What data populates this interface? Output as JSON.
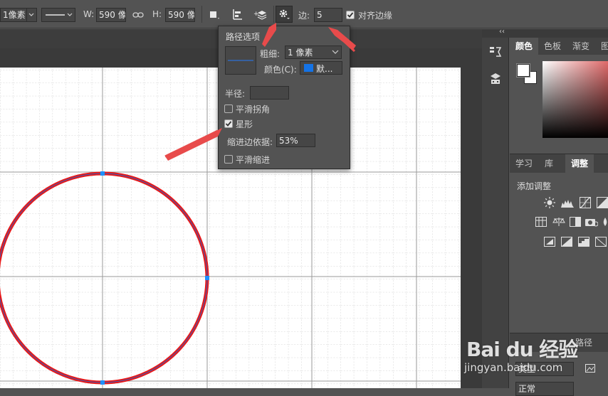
{
  "options_bar": {
    "stroke_width_value": "1像素",
    "w_label": "W:",
    "w_value": "590 像",
    "h_label": "H:",
    "h_value": "590 像",
    "sides_label": "边:",
    "sides_value": "5",
    "align_edges_label": "对齐边缘",
    "align_edges_checked": true
  },
  "path_options": {
    "title": "路径选项",
    "weight_label": "粗细:",
    "weight_value": "1 像素",
    "color_label": "颜色(C):",
    "color_value": "默...",
    "color_swatch": "#1473e6",
    "radius_label": "半径:",
    "radius_value": "",
    "smooth_corners_label": "平滑拐角",
    "smooth_corners_checked": false,
    "star_label": "星形",
    "star_checked": true,
    "indent_label": "缩进边依据:",
    "indent_value": "53%",
    "smooth_indents_label": "平滑缩进",
    "smooth_indents_checked": false
  },
  "right_panel": {
    "collapse_glyph": "‹‹",
    "color_tabs": [
      "颜色",
      "色板",
      "渐变",
      "图案"
    ],
    "adjust_tabs": [
      "学习",
      "库",
      "调整"
    ],
    "add_adjustment_label": "添加调整",
    "layers_tab_label": "路径",
    "kind_label": "类型",
    "normal_label": "正常"
  },
  "watermark": {
    "logo_text": "Bai du 经验",
    "url_text": "jingyan.baidu.com"
  },
  "colors": {
    "accent_blue": "#1473e6",
    "circle_red": "#e81818",
    "anchor_blue": "#1e8fff",
    "arrow_red": "#e84b4b"
  }
}
